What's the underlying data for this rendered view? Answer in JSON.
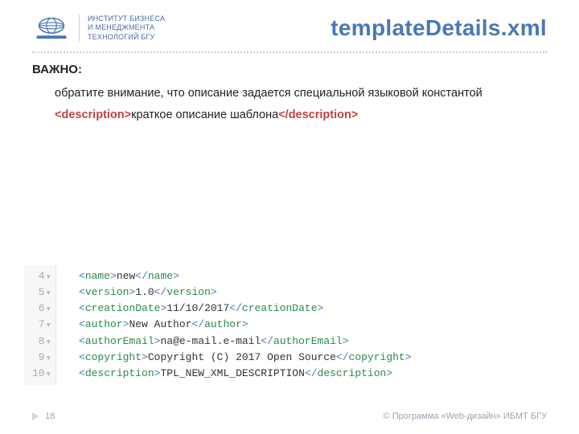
{
  "header": {
    "brand_lines": [
      "ИНСТИТУТ БИЗНЕСА",
      "И МЕНЕДЖМЕНТА",
      "ТЕХНОЛОГИЙ БГУ"
    ],
    "title": "templateDetails.xml"
  },
  "body": {
    "important_label": "ВАЖНО:",
    "paragraph": "обратите внимание, что описание задается специальной языковой константой",
    "description_tag_open": "<description>",
    "description_text": "краткое описание шаблона",
    "description_tag_close": "</description>"
  },
  "code": {
    "lines": [
      {
        "num": "4",
        "tag": "name",
        "text": "new"
      },
      {
        "num": "5",
        "tag": "version",
        "text": "1.0"
      },
      {
        "num": "6",
        "tag": "creationDate",
        "text": "11/10/2017"
      },
      {
        "num": "7",
        "tag": "author",
        "text": "New Author"
      },
      {
        "num": "8",
        "tag": "authorEmail",
        "text": "na@e-mail.e-mail"
      },
      {
        "num": "9",
        "tag": "copyright",
        "text": "Copyright (C) 2017 Open Source"
      },
      {
        "num": "10",
        "tag": "description",
        "text": "TPL_NEW_XML_DESCRIPTION"
      }
    ]
  },
  "footer": {
    "page_number": "18",
    "copyright": "© Программа «Web-дизайн» ИБМТ БГУ"
  }
}
